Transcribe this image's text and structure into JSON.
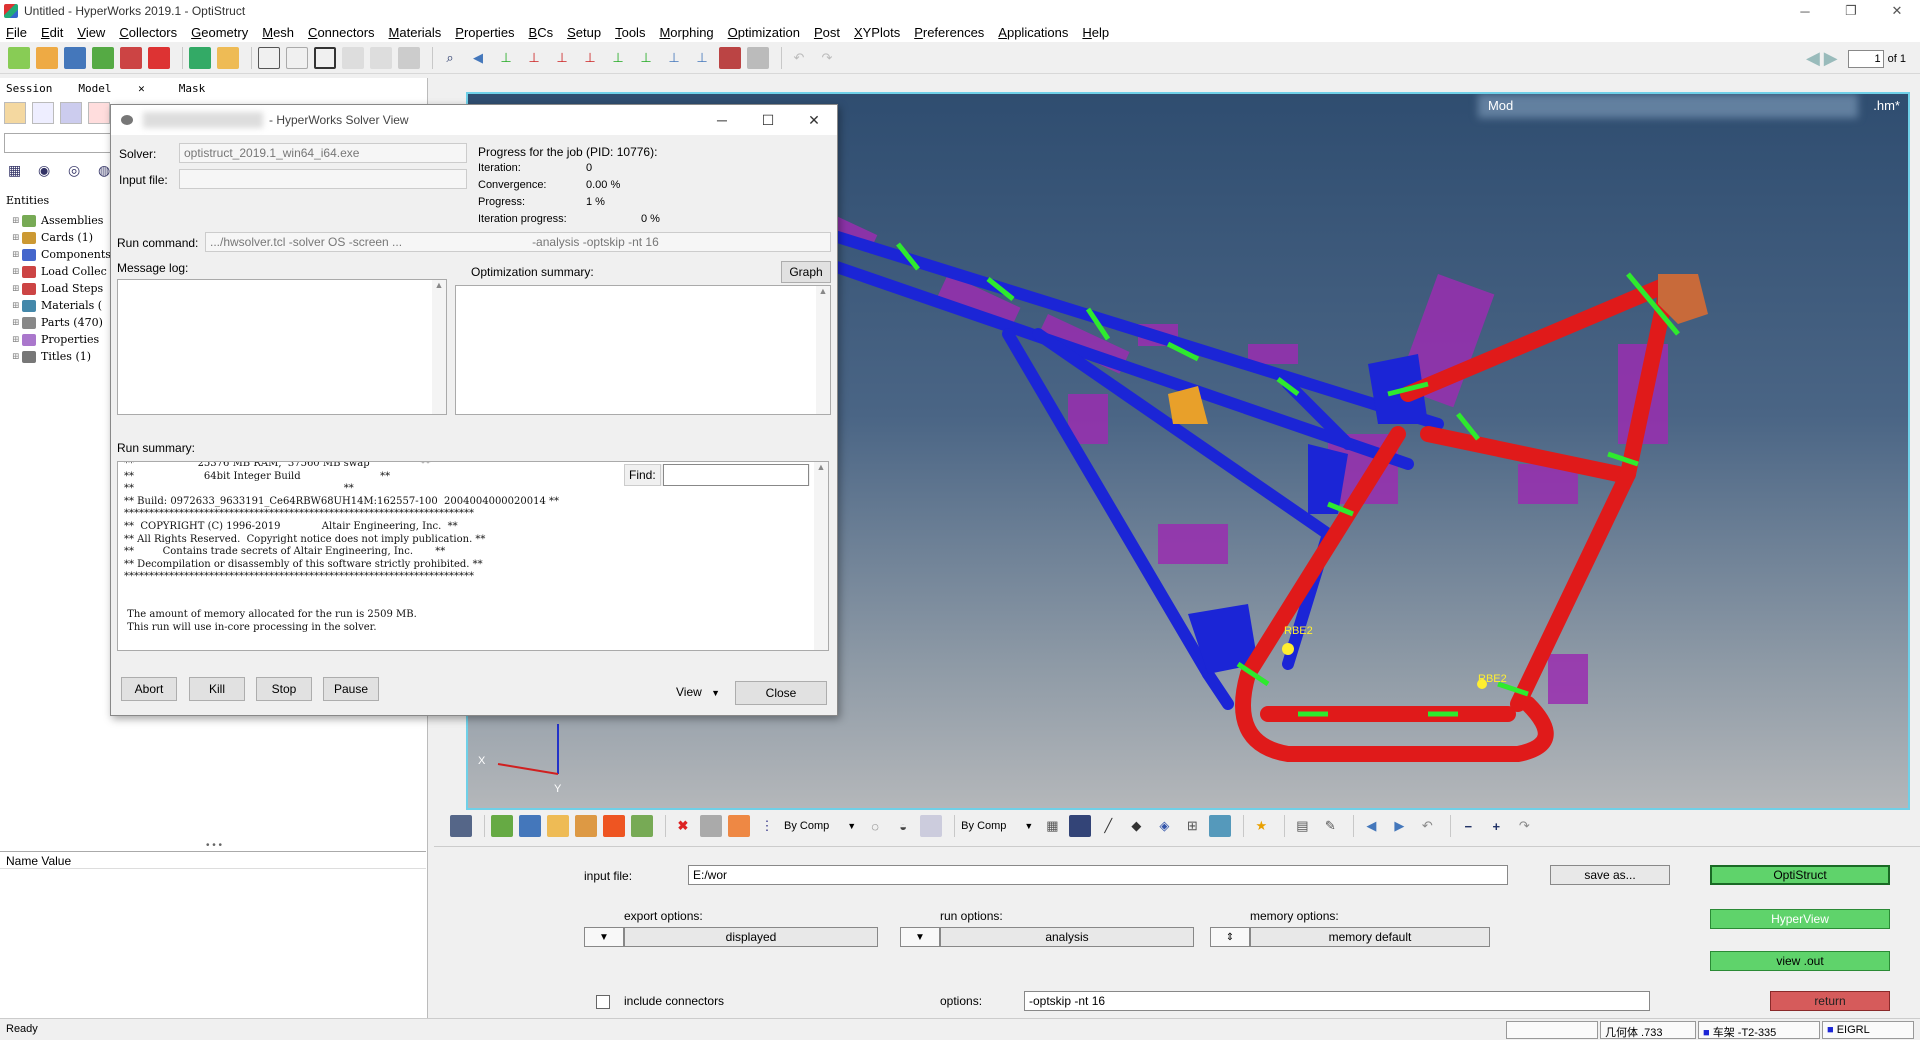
{
  "window": {
    "title": "Untitled - HyperWorks 2019.1 - OptiStruct",
    "controls": [
      "─",
      "❐",
      "✕"
    ]
  },
  "menu": [
    "File",
    "Edit",
    "View",
    "Collectors",
    "Geometry",
    "Mesh",
    "Connectors",
    "Materials",
    "Properties",
    "BCs",
    "Setup",
    "Tools",
    "Morphing",
    "Optimization",
    "Post",
    "XYPlots",
    "Preferences",
    "Applications",
    "Help"
  ],
  "pager": {
    "value": "1",
    "of": "of 1"
  },
  "left_panel": {
    "tabs": [
      "Session",
      "Model",
      "Mask"
    ],
    "tab_close": "✕",
    "entities_header": "Entities",
    "tree": [
      {
        "label": "Assemblies",
        "color": "#7a5"
      },
      {
        "label": "Cards (1)",
        "color": "#c93"
      },
      {
        "label": "Components",
        "color": "#46c"
      },
      {
        "label": "Load Collec",
        "color": "#c44"
      },
      {
        "label": "Load Steps",
        "color": "#c44"
      },
      {
        "label": "Materials (",
        "color": "#48a"
      },
      {
        "label": "Parts (470)",
        "color": "#888"
      },
      {
        "label": "Properties",
        "color": "#a7c"
      },
      {
        "label": "Titles (1)",
        "color": "#777"
      }
    ],
    "split_dots": "• • •",
    "name_value_header": "Name Value"
  },
  "viewport": {
    "title_left": "Mod",
    "title_right": ".hm*",
    "rbe_labels": [
      "RBE2",
      "RBE2"
    ],
    "axis": {
      "x": "X",
      "y": "Y"
    },
    "frame_colors": {
      "blue": "#1b25d6",
      "red": "#e01a1a",
      "green": "#2eea2e",
      "purple": "#9a2db0",
      "orange": "#e8a02a",
      "copper": "#c86a3a"
    }
  },
  "solver": {
    "title": "- HyperWorks Solver View",
    "solver_label": "Solver:",
    "solver_value": "optistruct_2019.1_win64_i64.exe",
    "input_file_label": "Input file:",
    "progress_header": "Progress for the job (PID: 10776):",
    "iteration_label": "Iteration:",
    "iteration_value": "0",
    "convergence_label": "Convergence:",
    "convergence_value": "0.00 %",
    "progress_label": "Progress:",
    "progress_value": "1 %",
    "iter_progress_label": "Iteration progress:",
    "iter_progress_value": "0 %",
    "run_command_label": "Run command:",
    "run_command_value": ".../hwsolver.tcl -solver OS -screen ...",
    "run_command_tail": "-analysis -optskip -nt 16",
    "message_log_label": "Message log:",
    "opt_summary_label": "Optimization summary:",
    "graph_button": "Graph",
    "run_summary_label": "Run summary:",
    "find_label": "Find:",
    "run_summary_text": "**                    25376 MB RAM,  37560 MB swap                **\n**                      64bit Integer Build                         **\n**                                                                  **\n** Build: 0972633_9633191_Ce64RBW68UH14M:162557-100  2004004000020014 **\n**********************************************************************\n**  COPYRIGHT (C) 1996-2019             Altair Engineering, Inc.  **\n** All Rights Reserved.  Copyright notice does not imply publication. **\n**         Contains trade secrets of Altair Engineering, Inc.       **\n** Decompilation or disassembly of this software strictly prohibited. **\n**********************************************************************\n\n\n The amount of memory allocated for the run is 2509 MB.\n This run will use in-core processing in the solver.",
    "buttons": {
      "abort": "Abort",
      "kill": "Kill",
      "stop": "Stop",
      "pause": "Pause",
      "view": "View",
      "close": "Close"
    }
  },
  "bottom_toolbar": {
    "by_comp_1": "By Comp",
    "by_comp_2": "By Comp"
  },
  "panel": {
    "input_file_label": "input file:",
    "input_file_value": "E:/wor",
    "save_as": "save as...",
    "optistruct": "OptiStruct",
    "hyperview": "HyperView",
    "view_out": "view .out",
    "return": "return",
    "export_options_label": "export options:",
    "export_options_value": "displayed",
    "run_options_label": "run options:",
    "run_options_value": "analysis",
    "memory_options_label": "memory options:",
    "memory_options_value": "memory default",
    "include_connectors": "include connectors",
    "options_label": "options:",
    "options_value": "-optskip -nt 16"
  },
  "status": {
    "ready": "Ready",
    "field1": "几何体 .733",
    "field2": "车架 -T2-335",
    "field3": "EIGRL"
  }
}
